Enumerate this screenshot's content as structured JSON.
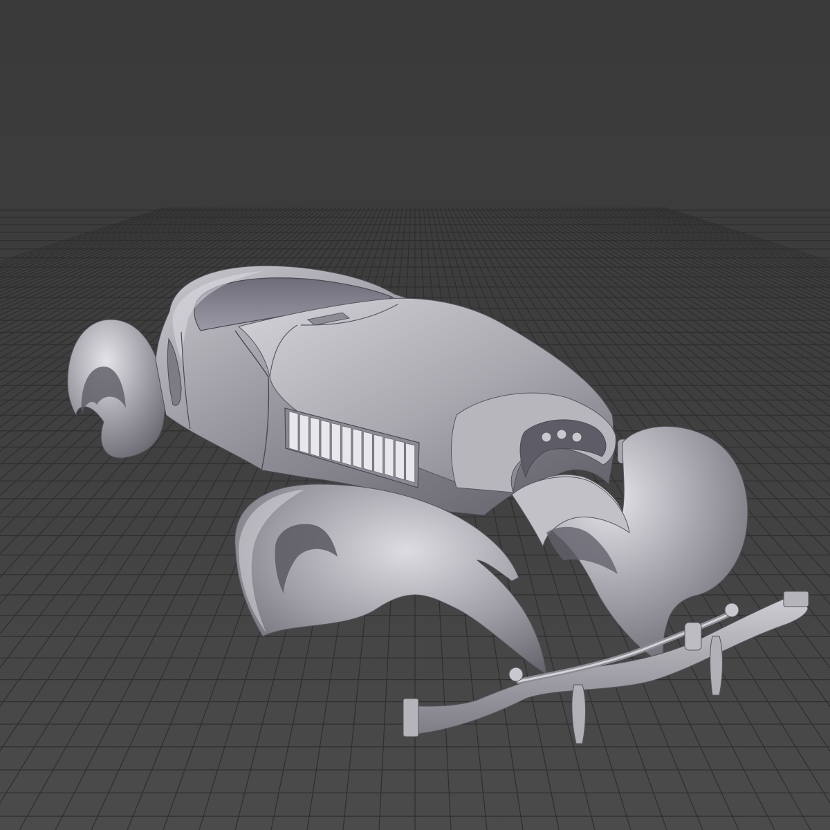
{
  "viewport": {
    "background_top": "#3a3a3a",
    "background_bottom": "#4a4a4a",
    "grid_color": "#2e2e2e",
    "grid_visible": true,
    "view": "perspective"
  },
  "model": {
    "material_color": "#a7a6ad",
    "material_shadow": "#5e5c64",
    "material_highlight": "#e6e6ea",
    "parts": [
      {
        "name": "body-shell",
        "icon": "car-body"
      },
      {
        "name": "hood",
        "icon": "hood-panel"
      },
      {
        "name": "side-louvers",
        "icon": "vent"
      },
      {
        "name": "rear-left-fender",
        "icon": "fender"
      },
      {
        "name": "front-left-fender",
        "icon": "fender"
      },
      {
        "name": "front-right-fender",
        "icon": "fender"
      },
      {
        "name": "front-axle",
        "icon": "axle"
      }
    ]
  }
}
